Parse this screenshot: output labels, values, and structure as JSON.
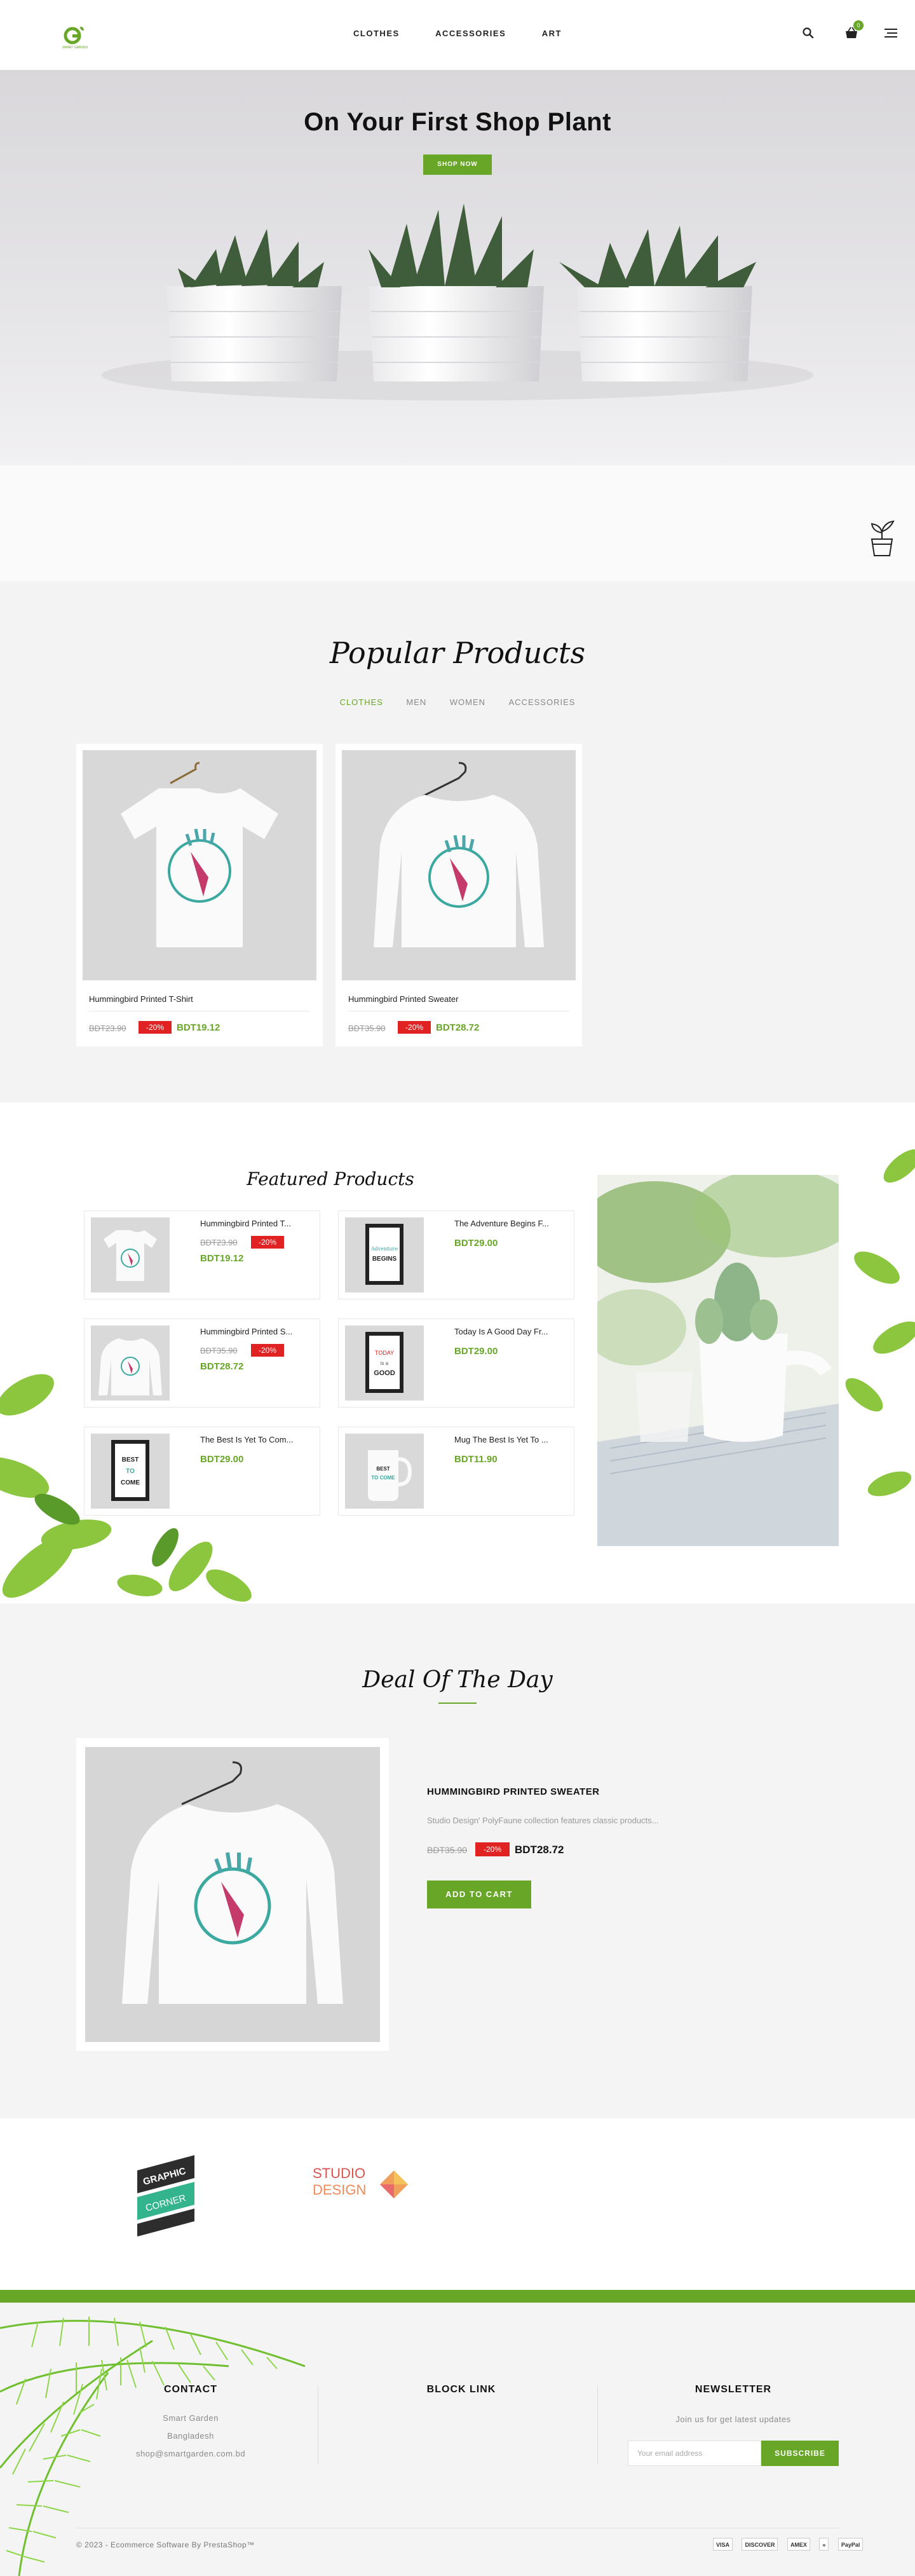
{
  "header": {
    "nav": [
      "CLOTHES",
      "ACCESSORIES",
      "ART"
    ],
    "cart_count": "0",
    "icons": {
      "search": "search-icon",
      "cart": "shopping-basket-icon",
      "menu": "menu-icon",
      "logo": "smart-garden-logo"
    }
  },
  "hero": {
    "title": "On Your First Shop Plant",
    "button": "SHOP NOW"
  },
  "popular": {
    "title": "Popular Products",
    "tabs": [
      "CLOTHES",
      "MEN",
      "WOMEN",
      "ACCESSORIES"
    ],
    "active_tab": "CLOTHES",
    "products": [
      {
        "name": "Hummingbird Printed T-Shirt",
        "old_price": "BDT23.90",
        "discount": "-20%",
        "price": "BDT19.12"
      },
      {
        "name": "Hummingbird Printed Sweater",
        "old_price": "BDT35.90",
        "discount": "-20%",
        "price": "BDT28.72"
      }
    ]
  },
  "featured": {
    "title": "Featured Products",
    "products": [
      {
        "name": "Hummingbird Printed T...",
        "old_price": "BDT23.90",
        "discount": "-20%",
        "price": "BDT19.12"
      },
      {
        "name": "The Adventure Begins F...",
        "price": "BDT29.00"
      },
      {
        "name": "Hummingbird Printed S...",
        "old_price": "BDT35.90",
        "discount": "-20%",
        "price": "BDT28.72"
      },
      {
        "name": "Today Is A Good Day Fr...",
        "price": "BDT29.00"
      },
      {
        "name": "The Best Is Yet To Com...",
        "price": "BDT29.00"
      },
      {
        "name": "Mug The Best Is Yet To ...",
        "price": "BDT11.90"
      }
    ]
  },
  "deal": {
    "title": "Deal Of The Day",
    "name": "HUMMINGBIRD PRINTED SWEATER",
    "description": "Studio Design' PolyFaune collection features classic products...",
    "old_price": "BDT35.90",
    "discount": "-20%",
    "price": "BDT28.72",
    "button": "ADD TO CART"
  },
  "brands": {
    "graphic_corner": [
      "GRAPHIC",
      "CORNER"
    ],
    "studio_design": [
      "STUDIO",
      "DESIGN"
    ]
  },
  "footer": {
    "contact": {
      "title": "CONTACT",
      "lines": [
        "Smart Garden",
        "Bangladesh",
        "shop@smartgarden.com.bd"
      ]
    },
    "block_link": {
      "title": "BLOCK LINK"
    },
    "newsletter": {
      "title": "NEWSLETTER",
      "text": "Join us for get latest updates",
      "placeholder": "Your email address",
      "button": "SUBSCRIBE"
    },
    "copyright": "© 2023 - Ecommerce Software By PrestaShop™",
    "payments": [
      "VISA",
      "DISCOVER",
      "AMEX",
      "»",
      "PayPal"
    ]
  },
  "colors": {
    "accent": "#68a627",
    "discount": "#e02222"
  }
}
